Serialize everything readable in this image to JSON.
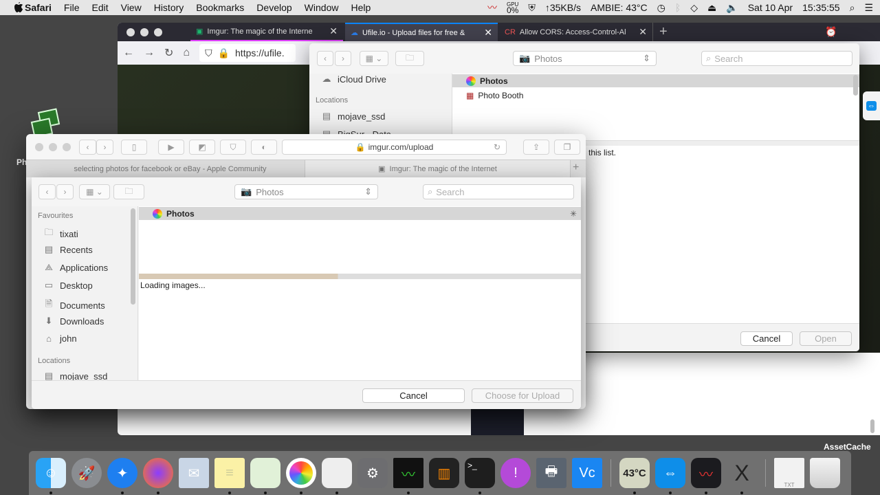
{
  "menubar": {
    "app": "Safari",
    "items": [
      "File",
      "Edit",
      "View",
      "History",
      "Bookmarks",
      "Develop",
      "Window",
      "Help"
    ],
    "gpu_label": "GPU",
    "gpu_value": "0%",
    "network": "↑35KB/s",
    "ambient": "AMBIE: 43°C",
    "date": "Sat 10 Apr",
    "time": "15:35:55"
  },
  "firefox": {
    "tabs": [
      {
        "label": "Imgur: The magic of the Interne"
      },
      {
        "label": "Ufile.io - Upload files for free &"
      },
      {
        "label": "Allow CORS: Access-Control-Al"
      }
    ],
    "url": "https://ufile."
  },
  "back_dialog": {
    "source": "Photos",
    "search_placeholder": "Search",
    "sidebar": {
      "icloud": "iCloud Drive",
      "locations_header": "Locations",
      "items": [
        "mojave_ssd",
        "BigSur - Data"
      ]
    },
    "rows": [
      "Photos",
      "Photo Booth"
    ],
    "message": "n this list.",
    "cancel": "Cancel",
    "open": "Open"
  },
  "safari": {
    "url": "imgur.com/upload",
    "tabs": [
      "selecting photos for facebook or eBay - Apple Community",
      "Imgur: The magic of the Internet"
    ]
  },
  "front_dialog": {
    "source": "Photos",
    "search_placeholder": "Search",
    "favourites_header": "Favourites",
    "favourites": [
      "tixati",
      "Recents",
      "Applications",
      "Desktop",
      "Documents",
      "Downloads",
      "john"
    ],
    "locations_header": "Locations",
    "locations": [
      "mojave_ssd"
    ],
    "rows": [
      "Photos"
    ],
    "loading": "Loading images...",
    "cancel": "Cancel",
    "choose": "Choose for Upload"
  },
  "desktop": {
    "icon_label": "Ph",
    "asset_label": "AssetCache"
  },
  "dock": {
    "temp_label": "43°C",
    "apps": [
      "Finder",
      "Launchpad",
      "Safari",
      "Firefox",
      "Mail",
      "Notes",
      "Maps",
      "Photos",
      "Photo Booth",
      "System Preferences",
      "Activity Monitor",
      "Tixati",
      "Terminal",
      "Feedback Assistant",
      "Printer",
      "VNC Viewer",
      "Temperature",
      "TeamViewer",
      "Stats",
      "XQuartz",
      "TXT",
      "Trash"
    ]
  }
}
